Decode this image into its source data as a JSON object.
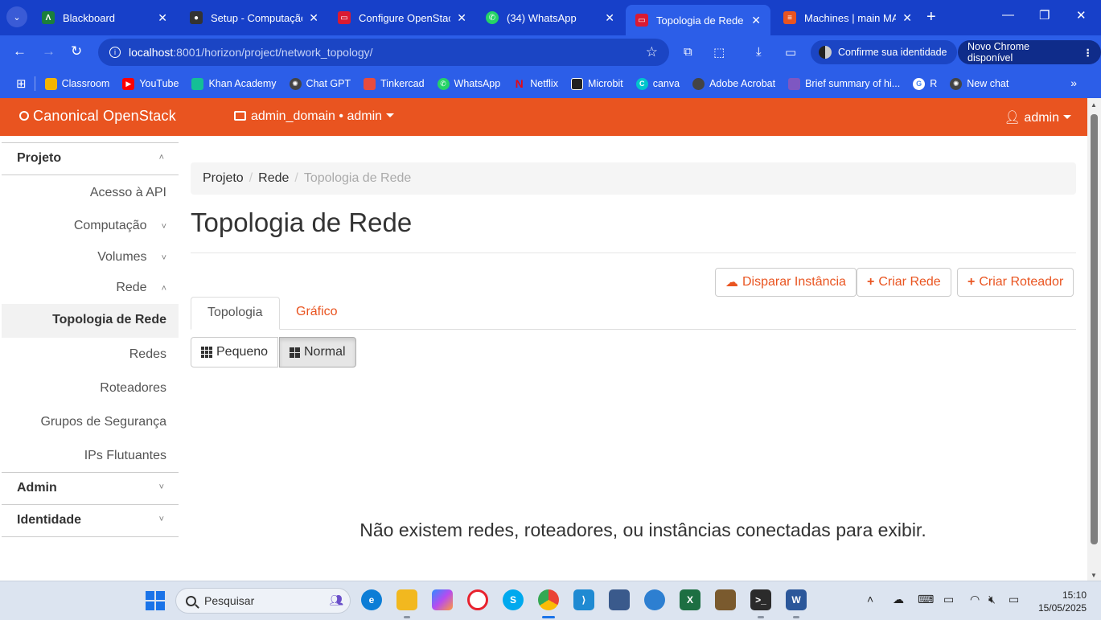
{
  "browser": {
    "tabs": [
      {
        "title": "Blackboard",
        "icon": "blackboard-icon",
        "color": "#1b7f3b",
        "glyph": "Λ"
      },
      {
        "title": "Setup - Computação",
        "icon": "github-icon",
        "color": "#333333",
        "glyph": "●"
      },
      {
        "title": "Configure OpenStack",
        "icon": "openstack-icon",
        "color": "#da1a32",
        "glyph": "▭"
      },
      {
        "title": "(34) WhatsApp",
        "icon": "whatsapp-icon",
        "color": "#25d366",
        "glyph": "✆"
      },
      {
        "title": "Topologia de Rede - O",
        "icon": "openstack-icon",
        "color": "#da1a32",
        "glyph": "▭"
      },
      {
        "title": "Machines | main MAA",
        "icon": "maas-icon",
        "color": "#e95420",
        "glyph": "≡"
      }
    ],
    "active_tab_index": 4,
    "url_host": "localhost",
    "url_path": ":8001/horizon/project/network_topology/",
    "identity_label": "Confirme sua identidade",
    "update_label": "Novo Chrome disponível",
    "bookmarks": [
      {
        "label": "Classroom",
        "icon": "classroom-icon",
        "color": "#f4b400"
      },
      {
        "label": "YouTube",
        "icon": "youtube-icon",
        "color": "#ff0000"
      },
      {
        "label": "Khan Academy",
        "icon": "khan-academy-icon",
        "color": "#14bf96"
      },
      {
        "label": "Chat GPT",
        "icon": "chatgpt-icon",
        "color": "#444444"
      },
      {
        "label": "Tinkercad",
        "icon": "tinkercad-icon",
        "color": "#e84c3d"
      },
      {
        "label": "WhatsApp",
        "icon": "whatsapp-icon",
        "color": "#25d366"
      },
      {
        "label": "Netflix",
        "icon": "netflix-icon",
        "color": "#e50914"
      },
      {
        "label": "Microbit",
        "icon": "microbit-icon",
        "color": "#222222"
      },
      {
        "label": "canva",
        "icon": "canva-icon",
        "color": "#00c4cc"
      },
      {
        "label": "Adobe Acrobat",
        "icon": "adobe-acrobat-icon",
        "color": "#444444"
      },
      {
        "label": "Brief summary of hi...",
        "icon": "doc-icon",
        "color": "#7e57c2"
      },
      {
        "label": "R",
        "icon": "google-icon",
        "color": "#4285f4"
      },
      {
        "label": "New chat",
        "icon": "chatgpt-icon",
        "color": "#444444"
      }
    ]
  },
  "header": {
    "brand": "Canonical OpenStack",
    "project_selector": "admin_domain • admin",
    "user_menu": "admin",
    "accent_color": "#e95420"
  },
  "sidebar": {
    "section_project": "Projeto",
    "api_access": "Acesso à API",
    "compute": "Computação",
    "volumes": "Volumes",
    "network": "Rede",
    "network_items": {
      "topology": "Topologia de Rede",
      "networks": "Redes",
      "routers": "Roteadores",
      "security_groups": "Grupos de Segurança",
      "floating_ips": "IPs Flutuantes"
    },
    "section_admin": "Admin",
    "section_identity": "Identidade"
  },
  "main": {
    "breadcrumb": [
      "Projeto",
      "Rede",
      "Topologia de Rede"
    ],
    "title": "Topologia de Rede",
    "actions": {
      "launch_instance": "Disparar Instância",
      "create_network": "Criar Rede",
      "create_router": "Criar Roteador"
    },
    "tabs": {
      "topology": "Topologia",
      "graph": "Gráfico"
    },
    "size_toggle": {
      "small": "Pequeno",
      "normal": "Normal",
      "selected": "Normal"
    },
    "empty_message": "Não existem redes, roteadores, ou instâncias conectadas para exibir."
  },
  "taskbar": {
    "search_label": "Pesquisar",
    "time": "15:10",
    "date": "15/05/2025"
  }
}
